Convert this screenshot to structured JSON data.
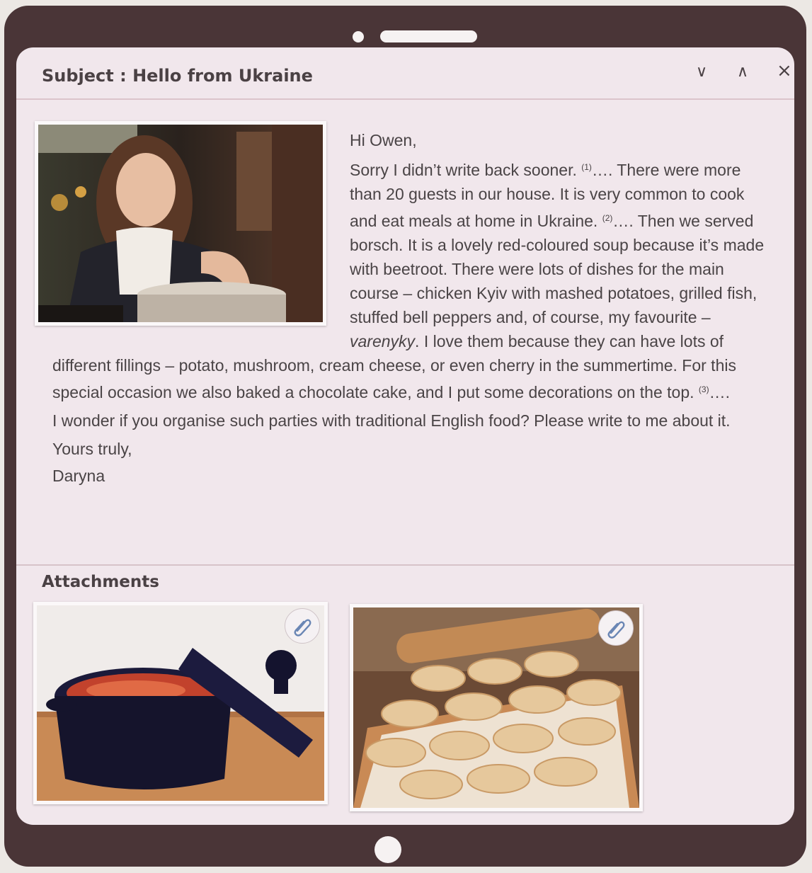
{
  "email": {
    "subject": "Subject : Hello from Ukraine",
    "controls": {
      "down": "∨",
      "up": "∧",
      "close": "×"
    },
    "greeting": "Hi Owen,",
    "intro": "Sorry I didn’t write back sooner. ",
    "gap1_num": "(1)",
    "gap_dots": "….",
    "para1a": " There were more than 20 guests in our house. It is very common to cook and eat meals at home in Ukraine. ",
    "gap2_num": "(2)",
    "para1b": " Then we served borsch. It is a lovely red-coloured soup because it’s made with beetroot. There were lots of dishes for the main course – chicken Kyiv with mashed potatoes, grilled fish, stuffed bell peppers and, of course, my favourite – ",
    "varenyky": "varenyky",
    "para1c": ". I love them because they can have lots of different fillings – potato, mushroom, cream cheese, or even cherry in the summertime. For this special occasion we also baked a chocolate cake, and I put some decorations on the top. ",
    "gap3_num": "(3)",
    "question": "I wonder if you organise such parties with traditional English food? Please write to me about it.",
    "closing": "Yours truly,",
    "signature": "Daryna"
  },
  "attachments": {
    "title": "Attachments",
    "items": [
      {
        "icon": "paperclip-icon",
        "depicts": "pot-of-borsch"
      },
      {
        "icon": "paperclip-icon",
        "depicts": "varenyky-on-board"
      }
    ]
  },
  "colors": {
    "device_frame": "#4a3537",
    "screen_bg": "#f1e7ec",
    "text": "#4a4446"
  }
}
